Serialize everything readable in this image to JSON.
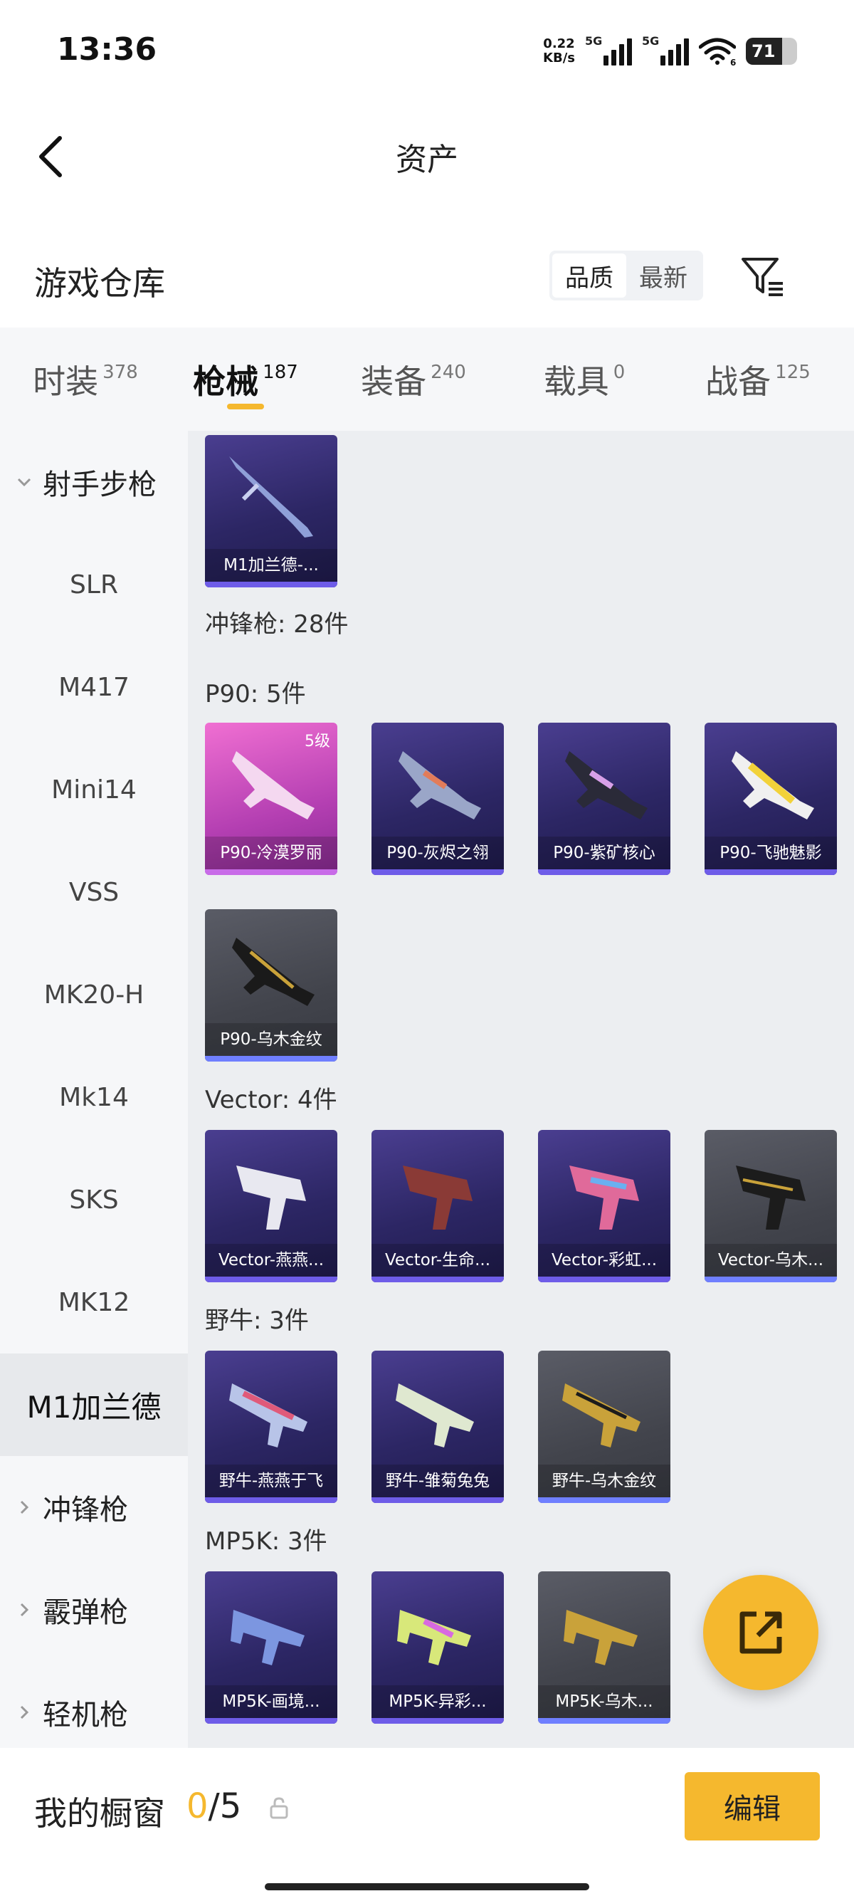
{
  "status_bar": {
    "time": "13:36",
    "net_speed_value": "0.22",
    "net_speed_unit": "KB/s",
    "signal1_label": "5G",
    "signal2_label": "5G",
    "wifi_badge": "6",
    "battery": "71",
    "battery_level": 0.71
  },
  "header": {
    "title": "资产"
  },
  "warehouse": {
    "title": "游戏仓库",
    "sort_options": [
      "品质",
      "最新"
    ],
    "sort_selected": "品质"
  },
  "tabs": [
    {
      "label": "时装",
      "count": "378",
      "active": false
    },
    {
      "label": "枪械",
      "count": "187",
      "active": true
    },
    {
      "label": "装备",
      "count": "240",
      "active": false
    },
    {
      "label": "载具",
      "count": "0",
      "active": false
    },
    {
      "label": "战备",
      "count": "125",
      "active": false
    }
  ],
  "sidebar": {
    "items": [
      {
        "label": "射手步枪",
        "type": "group",
        "expanded": true
      },
      {
        "label": "SLR",
        "type": "sub"
      },
      {
        "label": "M417",
        "type": "sub"
      },
      {
        "label": "Mini14",
        "type": "sub"
      },
      {
        "label": "VSS",
        "type": "sub"
      },
      {
        "label": "MK20-H",
        "type": "sub"
      },
      {
        "label": "Mk14",
        "type": "sub"
      },
      {
        "label": "SKS",
        "type": "sub"
      },
      {
        "label": "MK12",
        "type": "sub"
      },
      {
        "label": "M1加兰德",
        "type": "sub",
        "active": true
      },
      {
        "label": "冲锋枪",
        "type": "group",
        "expanded": false
      },
      {
        "label": "霰弹枪",
        "type": "group",
        "expanded": false
      },
      {
        "label": "轻机枪",
        "type": "group",
        "expanded": false
      }
    ]
  },
  "content": {
    "top_card": {
      "name": "M1加兰德-...",
      "rarity": "purple"
    },
    "category_label": "冲锋枪: 28件",
    "groups": [
      {
        "label": "P90: 5件",
        "cards": [
          {
            "name": "P90-冷漠罗丽",
            "rarity": "pink",
            "level": "5级"
          },
          {
            "name": "P90-灰烬之翎",
            "rarity": "purple"
          },
          {
            "name": "P90-紫矿核心",
            "rarity": "purple"
          },
          {
            "name": "P90-飞驰魅影",
            "rarity": "purple"
          },
          {
            "name": "P90-乌木金纹",
            "rarity": "gray"
          }
        ]
      },
      {
        "label": "Vector: 4件",
        "cards": [
          {
            "name": "Vector-燕燕...",
            "rarity": "purple"
          },
          {
            "name": "Vector-生命...",
            "rarity": "purple"
          },
          {
            "name": "Vector-彩虹...",
            "rarity": "purple"
          },
          {
            "name": "Vector-乌木...",
            "rarity": "gray"
          }
        ]
      },
      {
        "label": "野牛: 3件",
        "cards": [
          {
            "name": "野牛-燕燕于飞",
            "rarity": "purple"
          },
          {
            "name": "野牛-雏菊兔兔",
            "rarity": "purple"
          },
          {
            "name": "野牛-乌木金纹",
            "rarity": "gray"
          }
        ]
      },
      {
        "label": "MP5K: 3件",
        "cards": [
          {
            "name": "MP5K-画境...",
            "rarity": "purple"
          },
          {
            "name": "MP5K-异彩...",
            "rarity": "purple"
          },
          {
            "name": "MP5K-乌木...",
            "rarity": "gray"
          }
        ]
      }
    ]
  },
  "bottom_bar": {
    "label": "我的橱窗",
    "current": "0",
    "separator": "/",
    "max": "5",
    "edit_label": "编辑"
  },
  "colors": {
    "accent": "#f5b82e",
    "rarity_purple": "#6e5ce8",
    "rarity_pink": "#c86be8",
    "rarity_gray": "#6f7fff"
  },
  "icons": {
    "back": "chevron-left-icon",
    "filter": "filter-icon",
    "share": "external-link-icon",
    "lock": "lock-icon"
  }
}
